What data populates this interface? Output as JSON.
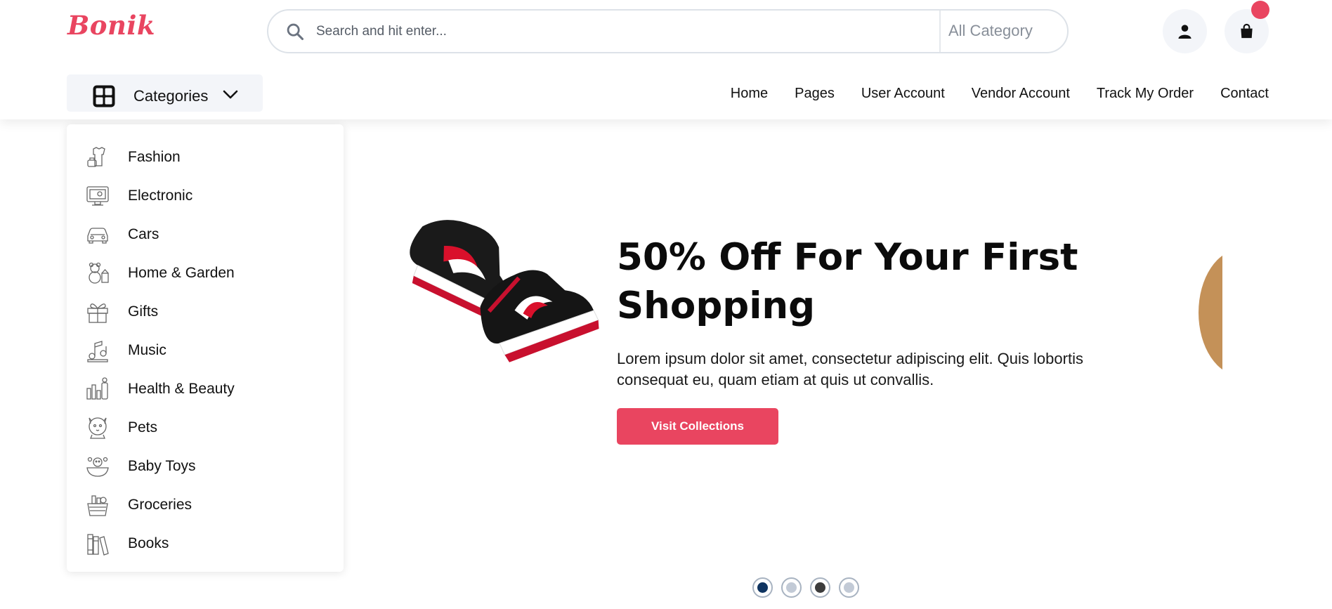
{
  "brand": {
    "logo_text": "Bonik",
    "color": "#e94560"
  },
  "search": {
    "placeholder": "Search and hit enter...",
    "category_label": "All Category",
    "icon": "search-icon"
  },
  "header_actions": {
    "user_icon": "user-icon",
    "cart_icon": "shopping-bag-icon"
  },
  "categories_toggle": {
    "label": "Categories",
    "icon": "grid-icon",
    "caret_icon": "chevron-down-icon"
  },
  "nav": [
    {
      "label": "Home"
    },
    {
      "label": "Pages"
    },
    {
      "label": "User Account"
    },
    {
      "label": "Vendor Account"
    },
    {
      "label": "Track My Order"
    },
    {
      "label": "Contact"
    }
  ],
  "category_menu": [
    {
      "label": "Fashion",
      "icon": "fashion-icon"
    },
    {
      "label": "Electronic",
      "icon": "electronic-icon"
    },
    {
      "label": "Cars",
      "icon": "car-icon"
    },
    {
      "label": "Home & Garden",
      "icon": "home-garden-icon"
    },
    {
      "label": "Gifts",
      "icon": "gift-icon"
    },
    {
      "label": "Music",
      "icon": "music-icon"
    },
    {
      "label": "Health & Beauty",
      "icon": "health-beauty-icon"
    },
    {
      "label": "Pets",
      "icon": "pets-icon"
    },
    {
      "label": "Baby Toys",
      "icon": "baby-toys-icon"
    },
    {
      "label": "Groceries",
      "icon": "groceries-icon"
    },
    {
      "label": "Books",
      "icon": "books-icon"
    }
  ],
  "hero": {
    "title": "50% Off For Your First Shopping",
    "text": "Lorem ipsum dolor sit amet, consectetur adipiscing elit. Quis lobortis consequat eu, quam etiam at quis ut convallis.",
    "button_label": "Visit Collections",
    "button_color": "#e94560"
  },
  "carousel": {
    "slides": 4,
    "dot_colors": [
      "#0f3460",
      "#c2cad6",
      "#3c3c3c",
      "#c2cad6"
    ]
  }
}
